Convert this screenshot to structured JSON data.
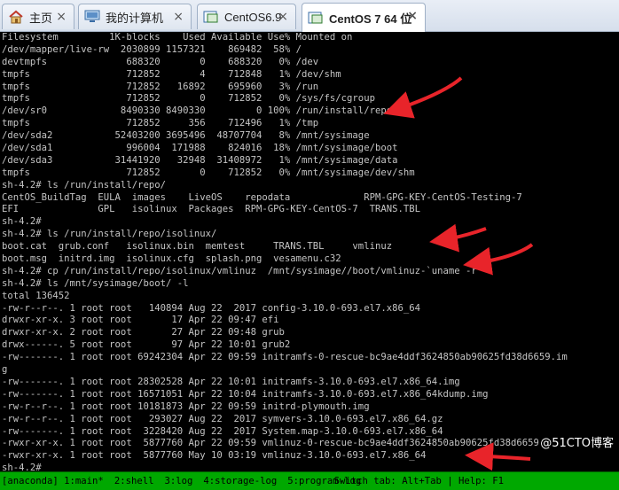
{
  "tabs": [
    {
      "label": "主页",
      "icon": "home-icon",
      "active": false
    },
    {
      "label": "我的计算机",
      "icon": "computer-icon",
      "active": false
    },
    {
      "label": "CentOS6.9",
      "icon": "vm-icon",
      "active": false
    },
    {
      "label": "CentOS 7 64 位",
      "icon": "vm-icon",
      "active": true
    }
  ],
  "terminal": {
    "lines": [
      "Filesystem         1K-blocks    Used Available Use% Mounted on",
      "/dev/mapper/live-rw  2030899 1157321    869482  58% /",
      "devtmpfs              688320       0    688320   0% /dev",
      "tmpfs                 712852       4    712848   1% /dev/shm",
      "tmpfs                 712852   16892    695960   3% /run",
      "tmpfs                 712852       0    712852   0% /sys/fs/cgroup",
      "/dev/sr0             8490330 8490330         0 100% /run/install/repo",
      "tmpfs                 712852     356    712496   1% /tmp",
      "/dev/sda2           52403200 3695496  48707704   8% /mnt/sysimage",
      "/dev/sda1             996004  171988    824016  18% /mnt/sysimage/boot",
      "/dev/sda3           31441920   32948  31408972   1% /mnt/sysimage/data",
      "tmpfs                 712852       0    712852   0% /mnt/sysimage/dev/shm",
      "sh-4.2# ls /run/install/repo/",
      "CentOS_BuildTag  EULA  images    LiveOS    repodata             RPM-GPG-KEY-CentOS-Testing-7",
      "EFI              GPL   isolinux  Packages  RPM-GPG-KEY-CentOS-7  TRANS.TBL",
      "sh-4.2#",
      "sh-4.2# ls /run/install/repo/isolinux/",
      "boot.cat  grub.conf   isolinux.bin  memtest     TRANS.TBL     vmlinuz",
      "boot.msg  initrd.img  isolinux.cfg  splash.png  vesamenu.c32",
      "sh-4.2# cp /run/install/repo/isolinux/vmlinuz  /mnt/sysimage//boot/vmlinuz-`uname -r`",
      "sh-4.2# ls /mnt/sysimage/boot/ -l",
      "total 136452",
      "-rw-r--r--. 1 root root   140894 Aug 22  2017 config-3.10.0-693.el7.x86_64",
      "drwxr-xr-x. 3 root root       17 Apr 22 09:47 efi",
      "drwxr-xr-x. 2 root root       27 Apr 22 09:48 grub",
      "drwx------. 5 root root       97 Apr 22 10:01 grub2",
      "-rw-------. 1 root root 69242304 Apr 22 09:59 initramfs-0-rescue-bc9ae4ddf3624850ab90625fd38d6659.im",
      "g",
      "-rw-------. 1 root root 28302528 Apr 22 10:01 initramfs-3.10.0-693.el7.x86_64.img",
      "-rw-------. 1 root root 16571051 Apr 22 10:04 initramfs-3.10.0-693.el7.x86_64kdump.img",
      "-rw-r--r--. 1 root root 10181873 Apr 22 09:59 initrd-plymouth.img",
      "-rw-r--r--. 1 root root   293027 Aug 22  2017 symvers-3.10.0-693.el7.x86_64.gz",
      "-rw-------. 1 root root  3228420 Aug 22  2017 System.map-3.10.0-693.el7.x86_64",
      "-rwxr-xr-x. 1 root root  5877760 Apr 22 09:59 vmlinuz-0-rescue-bc9ae4ddf3624850ab90625fd38d6659",
      "-rwxr-xr-x. 1 root root  5877760 May 10 03:19 vmlinuz-3.10.0-693.el7.x86_64",
      "sh-4.2#"
    ],
    "status": {
      "session": "[anaconda] 1:main*",
      "windows": [
        "2:shell",
        "3:log",
        "4:storage-log",
        "5:program-log"
      ],
      "hint": "Switch tab: Alt+Tab | Help: F1"
    }
  },
  "watermark": "@51CTO博客",
  "colors": {
    "terminal_bg": "#000000",
    "terminal_text": "#c4c4c4",
    "statusbar_bg": "#00a800",
    "arrow": "#e8242a"
  }
}
